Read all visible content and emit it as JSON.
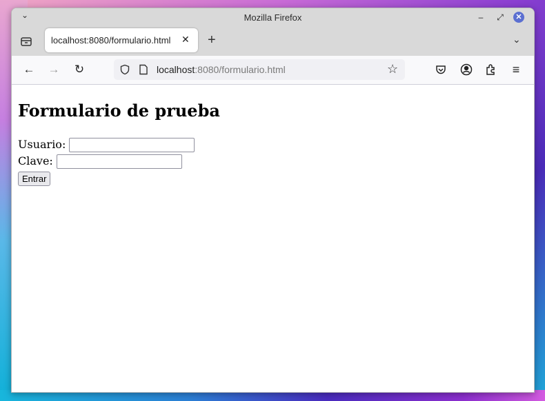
{
  "window": {
    "title": "Mozilla Firefox",
    "menu_chevron": "⌄",
    "minimize_glyph": "–",
    "maximize_glyph": "⤢",
    "close_glyph": "✕"
  },
  "tabs": [
    {
      "label": "localhost:8080/formulario.html",
      "close_glyph": "✕",
      "active": true
    }
  ],
  "tabbar": {
    "new_tab_glyph": "+",
    "overflow_glyph": "⌄"
  },
  "navbar": {
    "back_glyph": "←",
    "forward_glyph": "→",
    "reload_glyph": "↻",
    "url_host": "localhost",
    "url_rest": ":8080/formulario.html",
    "bookmark_glyph": "☆",
    "menu_glyph": "≡"
  },
  "page": {
    "heading": "Formulario de prueba",
    "user_label": "Usuario:",
    "user_value": "",
    "password_label": "Clave:",
    "password_value": "",
    "submit_label": "Entrar"
  },
  "colors": {
    "chrome_bg": "#d9d9d9",
    "close_button": "#5b6fd1"
  }
}
